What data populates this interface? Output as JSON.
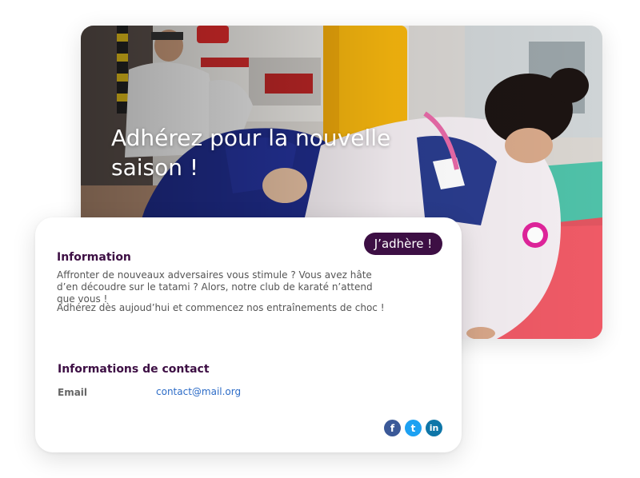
{
  "hero": {
    "title": "Adhérez pour la nouvelle saison !"
  },
  "card": {
    "join_button": "J’adhère !",
    "info_title": "Information",
    "paragraph_1": "Affronter de nouveaux adversaires vous stimule ? Vous avez hâte d’en découdre sur le tatami ? Alors, notre club de karaté n’attend que vous !",
    "paragraph_2": "Adhérez dès aujoud’hui et commencez nos entraînements de choc !",
    "contact_title": "Informations de contact",
    "email_label": "Email",
    "email_value": "contact@mail.org"
  },
  "socials": [
    {
      "name": "facebook",
      "glyph": "f"
    },
    {
      "name": "twitter",
      "glyph": "t"
    },
    {
      "name": "linkedin",
      "glyph": "in"
    }
  ],
  "colors": {
    "brand": "#3d0f44",
    "link": "#2d6cc7",
    "facebook": "#3b5998",
    "twitter": "#1da1f2",
    "linkedin": "#0e76a8"
  }
}
